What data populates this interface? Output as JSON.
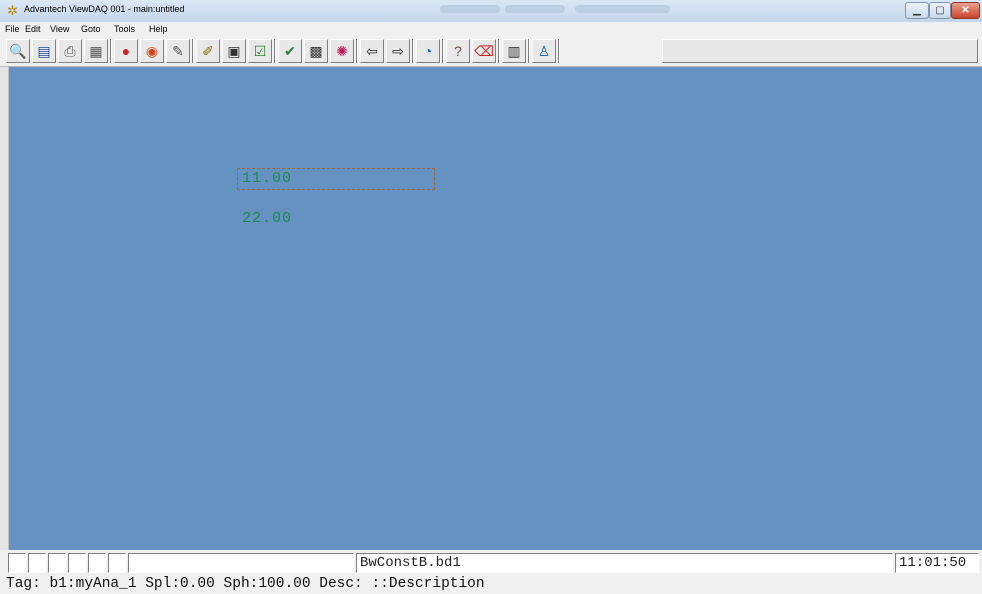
{
  "window": {
    "title": "Advantech ViewDAQ 001 - main:untitled",
    "app_icon": "advantech-gear-icon"
  },
  "menu": [
    {
      "label": "File"
    },
    {
      "label": "Edit"
    },
    {
      "label": "View"
    },
    {
      "label": "Goto"
    },
    {
      "label": "Tools"
    },
    {
      "label": "Help"
    }
  ],
  "toolbar": [
    {
      "icon": "magnifier-icon",
      "glyph": "🔍"
    },
    {
      "icon": "database-icon",
      "glyph": "▤"
    },
    {
      "icon": "printer-icon",
      "glyph": "⎙"
    },
    {
      "icon": "print-preview-icon",
      "glyph": "▦"
    },
    {
      "icon": "record-icon",
      "glyph": "●"
    },
    {
      "icon": "stop-record-icon",
      "glyph": "◉"
    },
    {
      "icon": "edit-pen-icon",
      "glyph": "✎"
    },
    {
      "icon": "edit-settings-icon",
      "glyph": "✐"
    },
    {
      "icon": "camera-icon",
      "glyph": "▣"
    },
    {
      "icon": "check-box-icon",
      "glyph": "☑"
    },
    {
      "icon": "checkmark-icon",
      "glyph": "✔"
    },
    {
      "icon": "tag-grid-icon",
      "glyph": "▩"
    },
    {
      "icon": "color-palette-icon",
      "glyph": "✺"
    },
    {
      "icon": "back-arrow-icon",
      "glyph": "⇦"
    },
    {
      "icon": "forward-arrow-icon",
      "glyph": "⇨"
    },
    {
      "icon": "pie-chart-icon",
      "glyph": "◔"
    },
    {
      "icon": "help-question-icon",
      "glyph": "?"
    },
    {
      "icon": "eraser-icon",
      "glyph": "⌫"
    },
    {
      "icon": "clapperboard-icon",
      "glyph": "▥"
    },
    {
      "icon": "user-icon",
      "glyph": "♙"
    }
  ],
  "canvas": {
    "background": "#6592c1",
    "value_1": "11.00",
    "value_2": "22.00",
    "value_color": "#1e8a4c"
  },
  "status": {
    "file": "BwConstB.bd1",
    "time": "11:01:50"
  },
  "info_line": "Tag: b1:myAna_1 Spl:0.00 Sph:100.00 Desc: ::Description"
}
